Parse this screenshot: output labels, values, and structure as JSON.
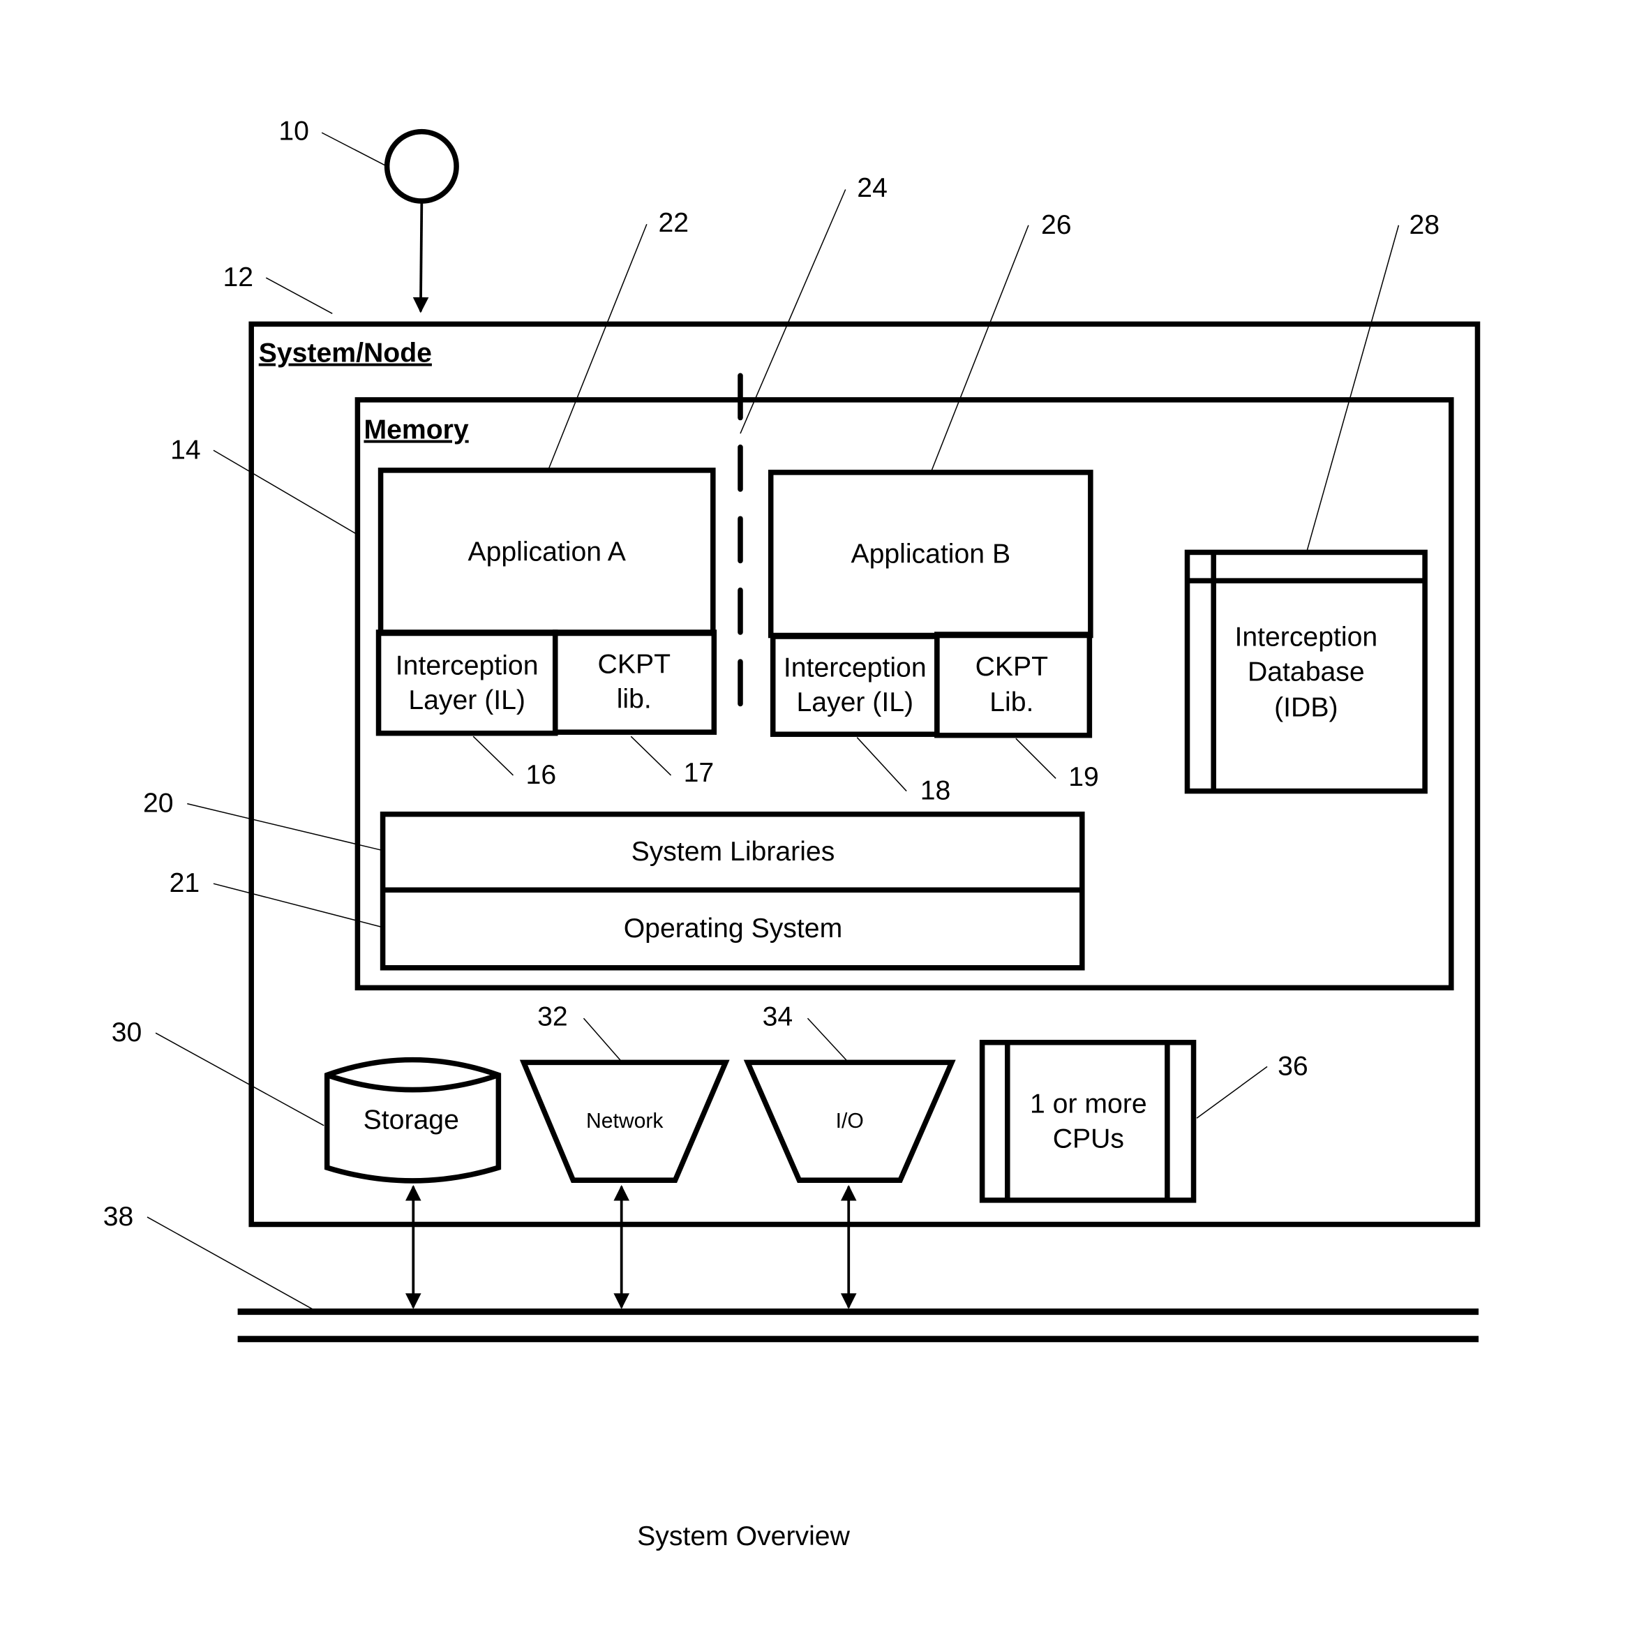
{
  "diagram": {
    "caption": "System Overview",
    "system_node": {
      "title": "System/Node",
      "ref": "12"
    },
    "user": {
      "ref": "10"
    },
    "memory": {
      "title": "Memory",
      "ref": "14"
    },
    "app_a": {
      "label": "Application A",
      "ref": "22",
      "il": {
        "line1": "Interception",
        "line2": "Layer (IL)",
        "ref": "16"
      },
      "ckpt": {
        "line1": "CKPT",
        "line2": "lib.",
        "ref": "17"
      }
    },
    "separator": {
      "ref": "24"
    },
    "app_b": {
      "label": "Application B",
      "ref": "26",
      "il": {
        "line1": "Interception",
        "line2": "Layer (IL)",
        "ref": "18"
      },
      "ckpt": {
        "line1": "CKPT",
        "line2": "Lib.",
        "ref": "19"
      }
    },
    "idb": {
      "line1": "Interception",
      "line2": "Database",
      "line3": "(IDB)",
      "ref": "28"
    },
    "system_libraries": {
      "label": "System Libraries",
      "ref": "20"
    },
    "operating_system": {
      "label": "Operating System",
      "ref": "21"
    },
    "storage": {
      "label": "Storage",
      "ref": "30"
    },
    "network": {
      "label": "Network",
      "ref": "32"
    },
    "io": {
      "label": "I/O",
      "ref": "34"
    },
    "cpus": {
      "line1": "1 or more",
      "line2": "CPUs",
      "ref": "36"
    },
    "bus": {
      "ref": "38"
    }
  }
}
